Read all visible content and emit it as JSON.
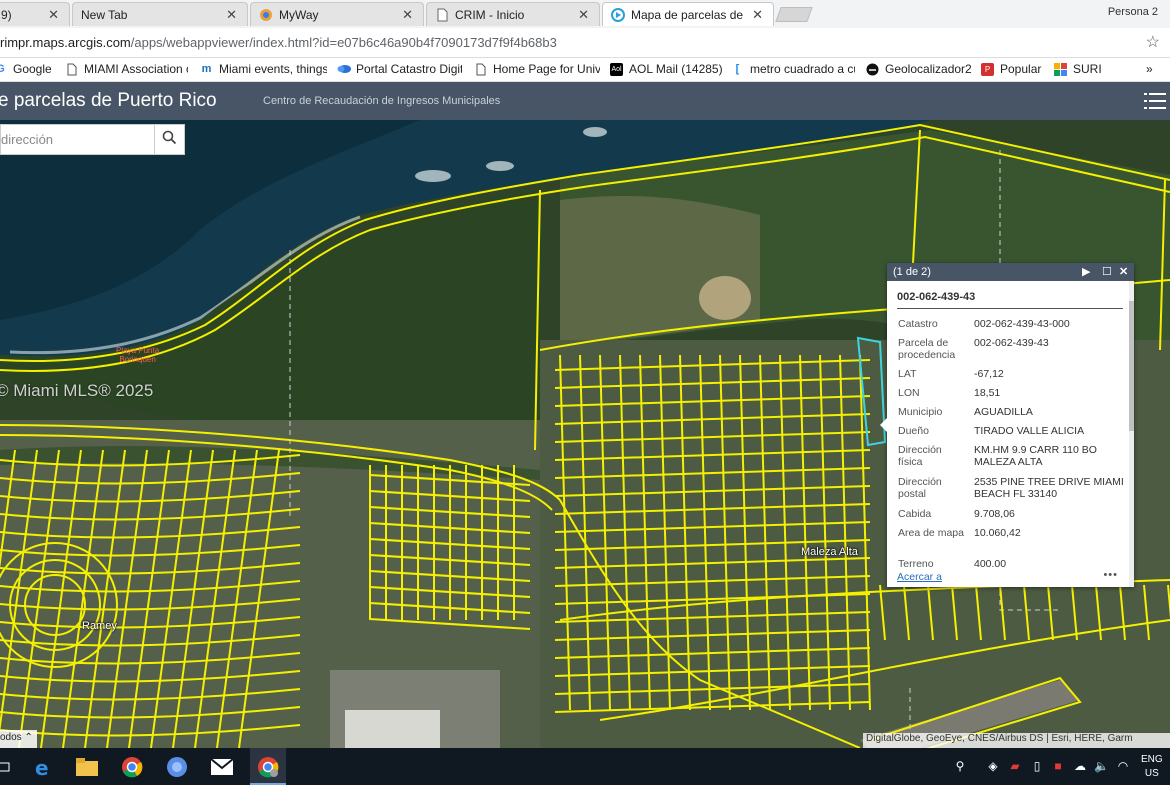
{
  "browser": {
    "tabs": [
      {
        "title": "9)",
        "active": false
      },
      {
        "title": "New Tab",
        "active": false
      },
      {
        "title": "MyWay",
        "active": false
      },
      {
        "title": "CRIM - Inicio",
        "active": false
      },
      {
        "title": "Mapa de parcelas de Pue",
        "active": true
      }
    ],
    "profile": "Persona 2",
    "url_host": "rimpr.maps.arcgis.com",
    "url_path": "/apps/webappviewer/index.html?id=e07b6c46a90b4f7090173d7f9f4b68b3",
    "bookmarks": [
      {
        "label": "Google",
        "icon": "google-icon"
      },
      {
        "label": "MIAMI Association o",
        "icon": "page-icon"
      },
      {
        "label": "Miami events, things",
        "icon": "meetup-icon"
      },
      {
        "label": "Portal Catastro Digit",
        "icon": "cloud-icon"
      },
      {
        "label": "Home Page for Univ",
        "icon": "page-icon"
      },
      {
        "label": "AOL Mail (14285)",
        "icon": "aol-icon"
      },
      {
        "label": "metro cuadrado a cu",
        "icon": "calc-icon"
      },
      {
        "label": "Geolocalizador2",
        "icon": "geo-icon"
      },
      {
        "label": "Popular",
        "icon": "popular-icon"
      },
      {
        "label": "SURI",
        "icon": "suri-icon"
      }
    ],
    "bookmarks_overflow": "»"
  },
  "app": {
    "title": "e parcelas de Puerto Rico",
    "subtitle": "Centro de Recaudación de Ingresos Municipales"
  },
  "search": {
    "placeholder": "dirección"
  },
  "map": {
    "watermark": "© Miami MLS® 2025",
    "labels": {
      "ramey": "Ramey",
      "maleza_alta": "Maleza Alta",
      "playa_line1": "Playa Punta",
      "playa_line2": "Borinquen"
    },
    "attribution": "DigitalGlobe, GeoEye, CNES/Airbus DS | Esri, HERE, Garm",
    "basemap_button": "odos"
  },
  "popup": {
    "count": "(1 de 2)",
    "title": "002-062-439-43",
    "attributes": [
      {
        "label": "Catastro",
        "value": "002-062-439-43-000"
      },
      {
        "label": "Parcela de procedencia",
        "value": "002-062-439-43"
      },
      {
        "label": "LAT",
        "value": "-67,12"
      },
      {
        "label": "LON",
        "value": "18,51"
      },
      {
        "label": "Municipio",
        "value": "AGUADILLA"
      },
      {
        "label": "Dueño",
        "value": "TIRADO VALLE ALICIA"
      },
      {
        "label": "Dirección física",
        "value": "KM.HM 9.9 CARR 110 BO MALEZA ALTA"
      },
      {
        "label": "Dirección postal",
        "value": "2535 PINE TREE DRIVE MIAMI BEACH FL 33140"
      },
      {
        "label": "Cabida",
        "value": "9.708,06"
      },
      {
        "label": "Area de mapa",
        "value": "10.060,42"
      },
      {
        "label": "Terreno",
        "value": "400.00"
      }
    ],
    "zoom_link": "Acercar a",
    "more": "•••"
  },
  "taskbar": {
    "lang_line1": "ENG",
    "lang_line2": "US"
  },
  "colors": {
    "header": "#485566",
    "parcel_line": "#f4f000",
    "selected_parcel": "#3fd3e0",
    "ocean": "#0f2b3a",
    "vegetation": "#2f4a2a"
  }
}
